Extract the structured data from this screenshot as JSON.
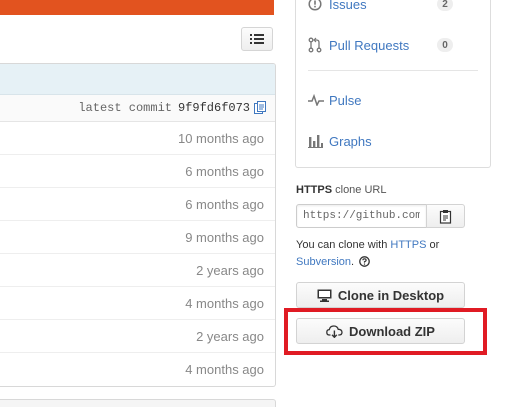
{
  "toolbar": {
    "view_toggle_icon": "list-icon"
  },
  "file_list": {
    "latest_commit_label": "latest commit",
    "latest_commit_sha": "9f9fd6f073",
    "rows": [
      {
        "age": "10 months ago"
      },
      {
        "age": "6 months ago"
      },
      {
        "age": "6 months ago"
      },
      {
        "age": "9 months ago"
      },
      {
        "age": "2 years ago"
      },
      {
        "age": "4 months ago"
      },
      {
        "age": "2 years ago"
      },
      {
        "age": "4 months ago"
      }
    ]
  },
  "sidebar": {
    "issues": {
      "label": "Issues",
      "count": "2",
      "icon": "issue-opened-icon"
    },
    "pull_requests": {
      "label": "Pull Requests",
      "count": "0",
      "icon": "git-pull-request-icon"
    },
    "pulse": {
      "label": "Pulse",
      "icon": "pulse-icon"
    },
    "graphs": {
      "label": "Graphs",
      "icon": "graph-icon"
    }
  },
  "clone": {
    "protocol": "HTTPS",
    "suffix": "clone URL",
    "url": "https://github.com/",
    "help_prefix": "You can clone with",
    "https_link": "HTTPS",
    "or_text": "or",
    "subversion_link": "Subversion",
    "period": "."
  },
  "buttons": {
    "desktop": "Clone in Desktop",
    "zip": "Download ZIP"
  },
  "colors": {
    "accent_bar": "#e2531f",
    "link": "#4078c0",
    "highlight": "#e01b24"
  }
}
